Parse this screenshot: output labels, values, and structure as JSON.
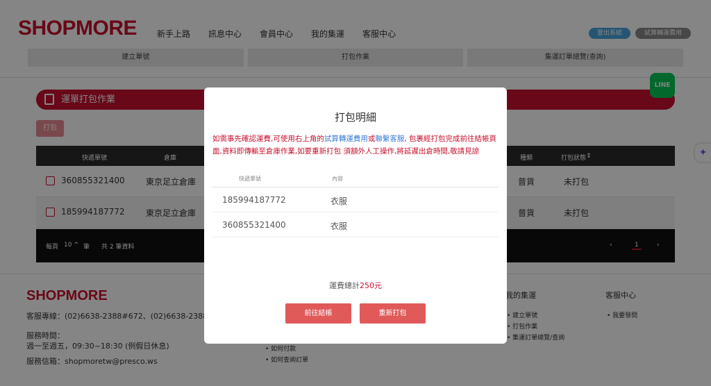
{
  "header": {
    "logo": "SHOPMORE",
    "nav": [
      "新手上路",
      "訊息中心",
      "會員中心",
      "我的集運",
      "客服中心"
    ],
    "logout": "登出系統",
    "calc": "試算轉運費用",
    "subtabs": [
      "建立單號",
      "打包作業",
      "集運訂單總覽(查詢)"
    ]
  },
  "main": {
    "section_title": "運單打包作業",
    "pack_button": "打包",
    "columns": {
      "tracking": "快遞單號",
      "warehouse": "倉庫",
      "type": "種類",
      "status": "打包狀態"
    },
    "rows": [
      {
        "tracking": "360855321400",
        "warehouse": "東京足立倉庫",
        "type": "普貨",
        "status": "未打包"
      },
      {
        "tracking": "185994187772",
        "warehouse": "東京足立倉庫",
        "type": "普貨",
        "status": "未打包"
      }
    ],
    "pager": {
      "per_page_label": "每頁",
      "per_page_value": "10",
      "unit": "筆",
      "total": "共 2 筆資料",
      "page": "1"
    }
  },
  "footer": {
    "logo": "SHOPMORE",
    "phone": "客服專線：(02)6638-2388#672、(02)6638-2388",
    "hours_label": "服務時間：",
    "hours_value": "週一至週五，09:30~18:30 (例假日休息)",
    "email": "服務信箱：shopmoretw@presco.ws",
    "col2_items": [
      "如何付款",
      "如何查詢訂單"
    ],
    "col3_title": "我的集運",
    "col3_items": [
      "建立單號",
      "打包作業",
      "集運訂單總覽/查詢"
    ],
    "col4_title": "客服中心",
    "col4_items": [
      "我要發問"
    ],
    "line_label": "LINE"
  },
  "modal": {
    "title": "打包明細",
    "note_part1": "如需事先確認運費,可使用右上角的",
    "note_link1": "試算轉運費用",
    "note_part2": "或",
    "note_link2": "聯繫客服",
    "note_part3": ", 包裹經打包完成前往結帳頁面,資料即傳輸至倉庫作業,如要重新打包 須額外人工操作,將延遲出倉時間,敬請見諒",
    "table_headers": {
      "tracking": "快遞單號",
      "content": "內容"
    },
    "items": [
      {
        "tracking": "185994187772",
        "content": "衣服"
      },
      {
        "tracking": "360855321400",
        "content": "衣服"
      }
    ],
    "total_label": "運費總計",
    "total_amount": "250元",
    "checkout_button": "前往結帳",
    "repack_button": "重新打包"
  },
  "colors": {
    "brand": "#c8102e",
    "link": "#3a7bd5",
    "modal_button": "#e05a5a"
  }
}
